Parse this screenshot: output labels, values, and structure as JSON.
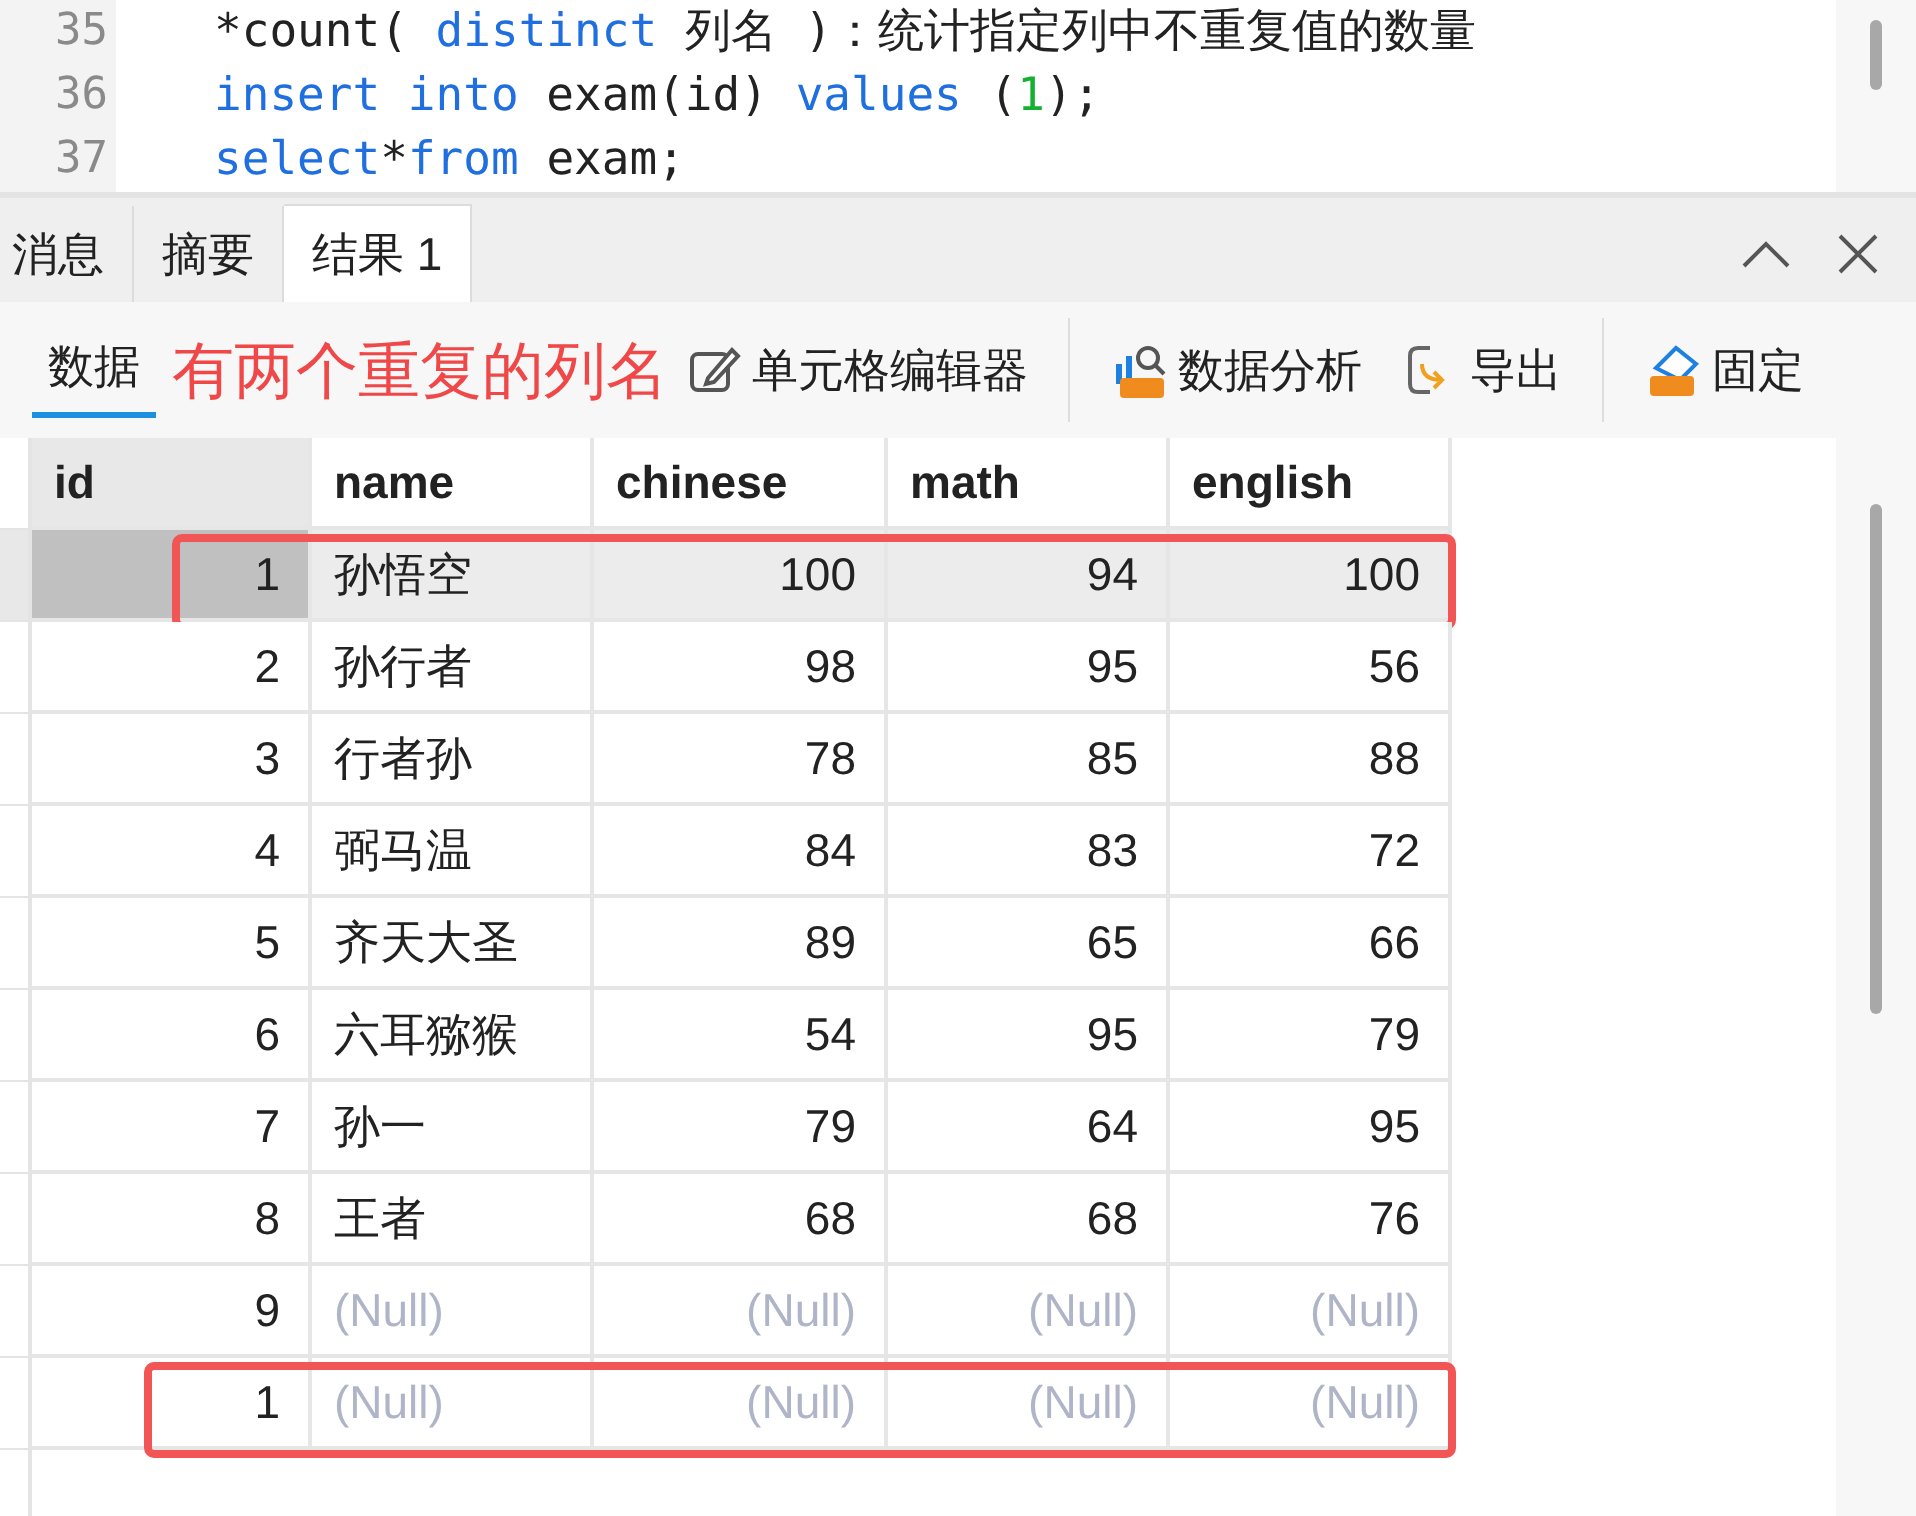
{
  "editor": {
    "lines": [
      {
        "number": "35",
        "tokens": [
          {
            "kind": "plain",
            "text": "*count( "
          },
          {
            "kind": "keyword",
            "text": "distinct"
          },
          {
            "kind": "plain",
            "text": " 列名 )：统计指定列中不重复值的数量"
          }
        ]
      },
      {
        "number": "36",
        "tokens": [
          {
            "kind": "keyword",
            "text": "insert into"
          },
          {
            "kind": "plain",
            "text": " exam(id) "
          },
          {
            "kind": "keyword",
            "text": "values"
          },
          {
            "kind": "plain",
            "text": " ("
          },
          {
            "kind": "number",
            "text": "1"
          },
          {
            "kind": "plain",
            "text": ");"
          }
        ]
      },
      {
        "number": "37",
        "tokens": [
          {
            "kind": "keyword",
            "text": "select"
          },
          {
            "kind": "plain",
            "text": "*"
          },
          {
            "kind": "keyword",
            "text": "from"
          },
          {
            "kind": "plain",
            "text": " exam;"
          }
        ]
      }
    ]
  },
  "result_tabs": [
    {
      "label": "消息",
      "selected": false
    },
    {
      "label": "摘要",
      "selected": false
    },
    {
      "label": "结果 1",
      "selected": true
    }
  ],
  "toolbar": {
    "view_tabs": [
      {
        "label": "数据",
        "selected": true
      }
    ],
    "actions": [
      {
        "kind": "cell-editor",
        "label": "单元格编辑器"
      },
      {
        "kind": "analysis",
        "label": "数据分析"
      },
      {
        "kind": "export",
        "label": "导出"
      },
      {
        "kind": "pin",
        "label": "固定"
      }
    ]
  },
  "annotation": {
    "text": "有两个重复的列名"
  },
  "table": {
    "columns": [
      {
        "label": "id",
        "kind": "number",
        "selected": true
      },
      {
        "label": "name",
        "kind": "text",
        "selected": false
      },
      {
        "label": "chinese",
        "kind": "number",
        "selected": false
      },
      {
        "label": "math",
        "kind": "number",
        "selected": false
      },
      {
        "label": "english",
        "kind": "number",
        "selected": false
      }
    ],
    "rows": [
      {
        "selected": true,
        "boxed": true,
        "cells": [
          {
            "text": "1",
            "null": false
          },
          {
            "text": "孙悟空",
            "null": false
          },
          {
            "text": "100",
            "null": false
          },
          {
            "text": "94",
            "null": false
          },
          {
            "text": "100",
            "null": false
          }
        ]
      },
      {
        "selected": false,
        "boxed": false,
        "cells": [
          {
            "text": "2",
            "null": false
          },
          {
            "text": "孙行者",
            "null": false
          },
          {
            "text": "98",
            "null": false
          },
          {
            "text": "95",
            "null": false
          },
          {
            "text": "56",
            "null": false
          }
        ]
      },
      {
        "selected": false,
        "boxed": false,
        "cells": [
          {
            "text": "3",
            "null": false
          },
          {
            "text": "行者孙",
            "null": false
          },
          {
            "text": "78",
            "null": false
          },
          {
            "text": "85",
            "null": false
          },
          {
            "text": "88",
            "null": false
          }
        ]
      },
      {
        "selected": false,
        "boxed": false,
        "cells": [
          {
            "text": "4",
            "null": false
          },
          {
            "text": "弼马温",
            "null": false
          },
          {
            "text": "84",
            "null": false
          },
          {
            "text": "83",
            "null": false
          },
          {
            "text": "72",
            "null": false
          }
        ]
      },
      {
        "selected": false,
        "boxed": false,
        "cells": [
          {
            "text": "5",
            "null": false
          },
          {
            "text": "齐天大圣",
            "null": false
          },
          {
            "text": "89",
            "null": false
          },
          {
            "text": "65",
            "null": false
          },
          {
            "text": "66",
            "null": false
          }
        ]
      },
      {
        "selected": false,
        "boxed": false,
        "cells": [
          {
            "text": "6",
            "null": false
          },
          {
            "text": "六耳猕猴",
            "null": false
          },
          {
            "text": "54",
            "null": false
          },
          {
            "text": "95",
            "null": false
          },
          {
            "text": "79",
            "null": false
          }
        ]
      },
      {
        "selected": false,
        "boxed": false,
        "cells": [
          {
            "text": "7",
            "null": false
          },
          {
            "text": "孙一",
            "null": false
          },
          {
            "text": "79",
            "null": false
          },
          {
            "text": "64",
            "null": false
          },
          {
            "text": "95",
            "null": false
          }
        ]
      },
      {
        "selected": false,
        "boxed": false,
        "cells": [
          {
            "text": "8",
            "null": false
          },
          {
            "text": "王者",
            "null": false
          },
          {
            "text": "68",
            "null": false
          },
          {
            "text": "68",
            "null": false
          },
          {
            "text": "76",
            "null": false
          }
        ]
      },
      {
        "selected": false,
        "boxed": false,
        "cells": [
          {
            "text": "9",
            "null": false
          },
          {
            "text": "(Null)",
            "null": true
          },
          {
            "text": "(Null)",
            "null": true
          },
          {
            "text": "(Null)",
            "null": true
          },
          {
            "text": "(Null)",
            "null": true
          }
        ]
      },
      {
        "selected": false,
        "boxed": true,
        "cells": [
          {
            "text": "1",
            "null": false
          },
          {
            "text": "(Null)",
            "null": true
          },
          {
            "text": "(Null)",
            "null": true
          },
          {
            "text": "(Null)",
            "null": true
          },
          {
            "text": "(Null)",
            "null": true
          }
        ]
      }
    ]
  }
}
